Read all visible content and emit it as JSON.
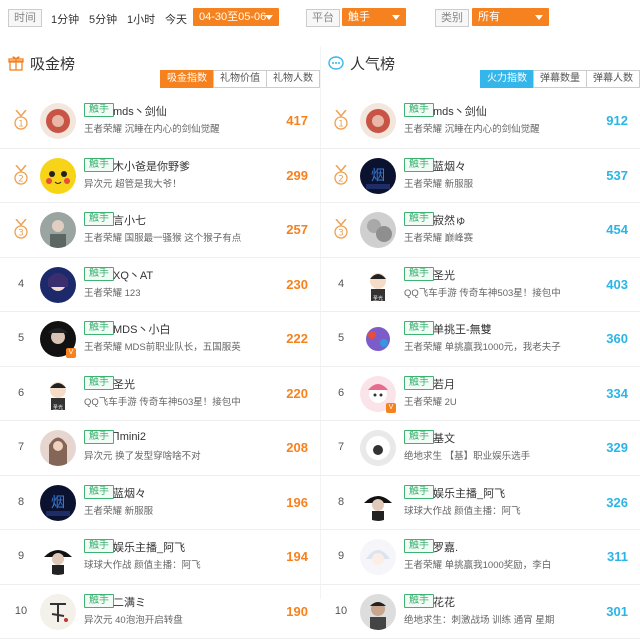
{
  "filters": {
    "time_label": "时间",
    "time_options": [
      "1分钟",
      "5分钟",
      "1小时",
      "今天"
    ],
    "time_selected": "04-30至05-06",
    "platform_label": "平台",
    "platform_selected": "触手",
    "category_label": "类别",
    "category_selected": "所有"
  },
  "colors": {
    "accent_orange": "#f5821f",
    "accent_blue": "#35b6ea",
    "tag_green": "#3cb371"
  },
  "left": {
    "title": "吸金榜",
    "title_icon": "gift-icon",
    "tabs": [
      "吸金指数",
      "礼物价值",
      "礼物人数"
    ],
    "active_tab": 0,
    "rows": [
      {
        "rank": "1",
        "tag": "触手",
        "name": "mds丶剑仙",
        "desc": "王者荣耀 沉睡在内心的剑仙觉醒",
        "score": "417",
        "avatar": "red-seal"
      },
      {
        "rank": "2",
        "tag": "触手",
        "name": "木小爸是你野爹",
        "desc": "异次元 超管是我大爷！",
        "score": "299",
        "avatar": "pikachu"
      },
      {
        "rank": "3",
        "tag": "触手",
        "name": "言小七",
        "desc": "王者荣耀 国服最一骚猴 这个猴子有点",
        "score": "257",
        "avatar": "photo-gray"
      },
      {
        "rank": "4",
        "tag": "触手",
        "name": "XQ丶AT",
        "desc": "王者荣耀 123",
        "score": "230",
        "avatar": "anime-blue"
      },
      {
        "rank": "5",
        "tag": "触手",
        "name": "MDS丶小白",
        "desc": "王者荣耀 MDS前职业队长，五国服英",
        "score": "222",
        "avatar": "dark-face",
        "badge": true
      },
      {
        "rank": "6",
        "tag": "触手",
        "name": "圣光",
        "desc": "QQ飞车手游 传奇车神503星！接包中",
        "score": "220",
        "avatar": "cartoon-boy"
      },
      {
        "rank": "7",
        "tag": "触手",
        "name": "ᒣmini2",
        "desc": "异次元 换了发型穿啥啥不对",
        "score": "208",
        "avatar": "photo-girl"
      },
      {
        "rank": "8",
        "tag": "触手",
        "name": "蓝烟々",
        "desc": "王者荣耀 新服服",
        "score": "196",
        "avatar": "blue-smoke"
      },
      {
        "rank": "9",
        "tag": "触手",
        "name": "娱乐主播_阿飞",
        "desc": "球球大作战 颜值主播：阿飞",
        "score": "194",
        "avatar": "man-dark"
      },
      {
        "rank": "10",
        "tag": "触手",
        "name": "二满ミ",
        "desc": "异次元 40泡泡开启转盘",
        "score": "190",
        "avatar": "calligraphy"
      }
    ]
  },
  "right": {
    "title": "人气榜",
    "title_icon": "chat-bubble-icon",
    "tabs": [
      "火力指数",
      "弹幕数量",
      "弹幕人数"
    ],
    "active_tab": 0,
    "rows": [
      {
        "rank": "1",
        "tag": "触手",
        "name": "mds丶剑仙",
        "desc": "王者荣耀 沉睡在内心的剑仙觉醒",
        "score": "912",
        "avatar": "red-seal"
      },
      {
        "rank": "2",
        "tag": "触手",
        "name": "蓝烟々",
        "desc": "王者荣耀 新服服",
        "score": "537",
        "avatar": "blue-smoke"
      },
      {
        "rank": "3",
        "tag": "触手",
        "name": "寂然ゅ",
        "desc": "王者荣耀 巅峰赛",
        "score": "454",
        "avatar": "sketch-gray"
      },
      {
        "rank": "4",
        "tag": "触手",
        "name": "圣光",
        "desc": "QQ飞车手游 传奇车神503星！接包中",
        "score": "403",
        "avatar": "cartoon-boy"
      },
      {
        "rank": "5",
        "tag": "触手",
        "name": "单挑王-無雙",
        "desc": "王者荣耀 单挑赢我1000元，我老夫子",
        "score": "360",
        "avatar": "anime-colorful"
      },
      {
        "rank": "6",
        "tag": "触手",
        "name": "若月",
        "desc": "王者荣耀 2U",
        "score": "334",
        "avatar": "anime-pink",
        "badge": true
      },
      {
        "rank": "7",
        "tag": "触手",
        "name": "基文",
        "desc": "绝地求生 【基】职业娱乐选手",
        "score": "329",
        "avatar": "white-hood"
      },
      {
        "rank": "8",
        "tag": "触手",
        "name": "娱乐主播_阿飞",
        "desc": "球球大作战 颜值主播：阿飞",
        "score": "326",
        "avatar": "man-dark"
      },
      {
        "rank": "9",
        "tag": "触手",
        "name": "罗嘉.",
        "desc": "王者荣耀 单挑赢我1000奖励，李白",
        "score": "311",
        "avatar": "anime-white"
      },
      {
        "rank": "10",
        "tag": "触手",
        "name": "花花",
        "desc": "绝地求生：刺激战场 训练 通宵 星期",
        "score": "301",
        "avatar": "man-photo"
      }
    ]
  }
}
